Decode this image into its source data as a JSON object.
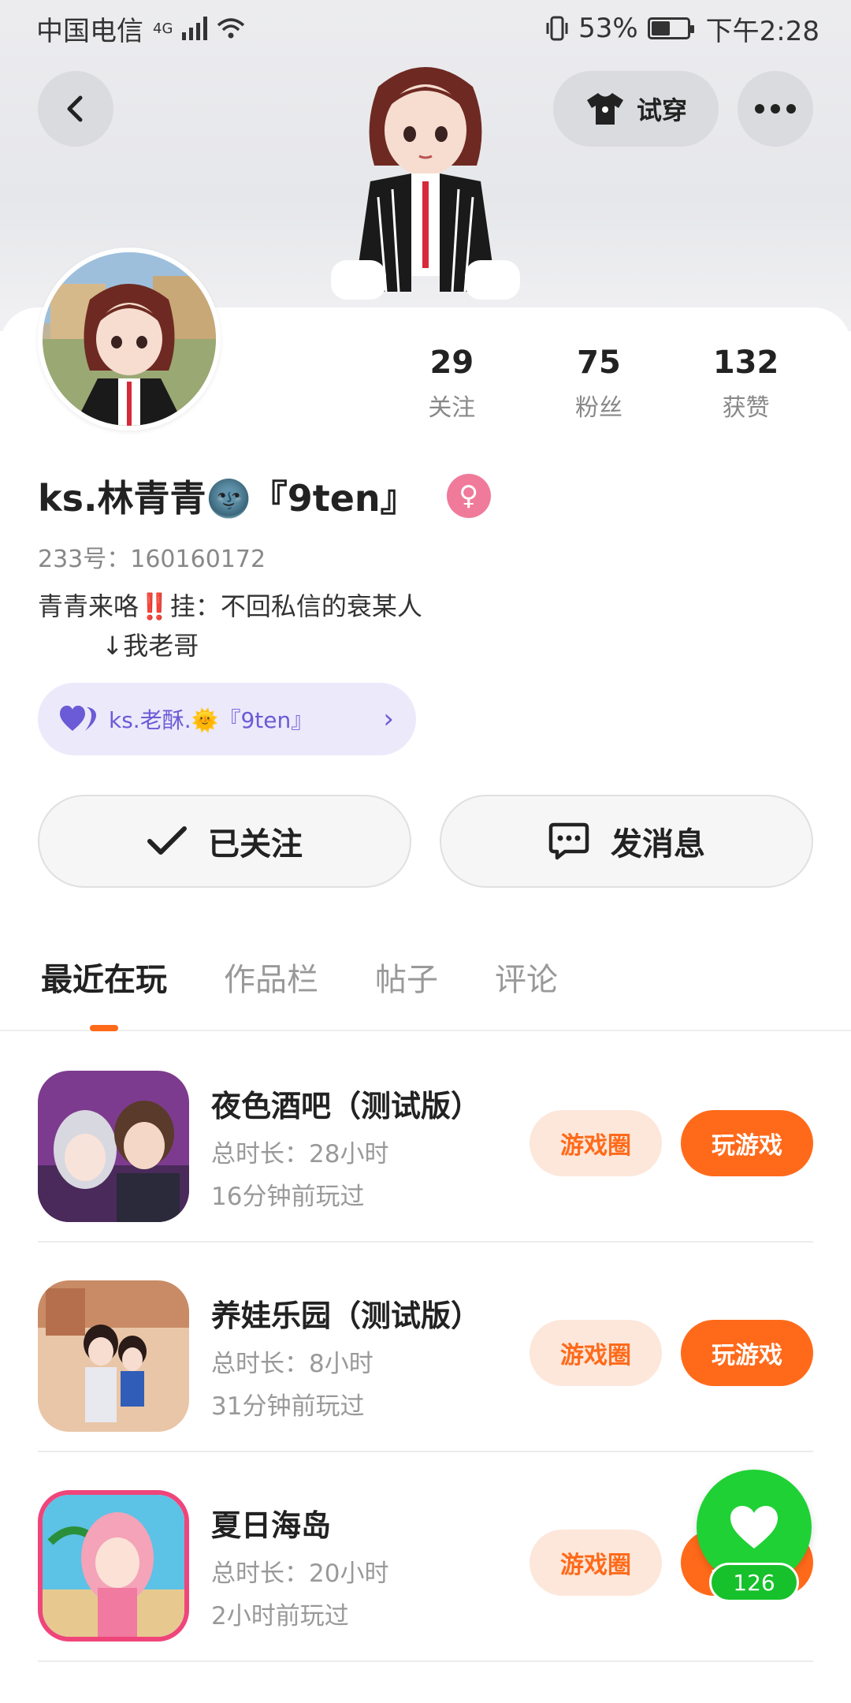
{
  "status_bar": {
    "carrier": "中国电信",
    "network": "4G",
    "battery": "53%",
    "battery_level": 0.53,
    "time": "下午2:28"
  },
  "top_bar": {
    "tryon_label": "试穿"
  },
  "profile": {
    "username": "ks.林青青🌚『9ten』",
    "gender_symbol": "♀",
    "uid": "233号：160160172",
    "bio": "青青来咯‼️挂：不回私信的衰某人\n        ↓我老哥",
    "relation_label": "ks.老酥.🌞『9ten』"
  },
  "stats": [
    {
      "value": "29",
      "label": "关注"
    },
    {
      "value": "75",
      "label": "粉丝"
    },
    {
      "value": "132",
      "label": "获赞"
    }
  ],
  "actions": {
    "follow_label": "已关注",
    "message_label": "发消息"
  },
  "tabs": [
    {
      "label": "最近在玩",
      "active": true
    },
    {
      "label": "作品栏",
      "active": false
    },
    {
      "label": "帖子",
      "active": false
    },
    {
      "label": "评论",
      "active": false
    }
  ],
  "games": [
    {
      "title": "夜色酒吧（测试版）",
      "total_time": "总时长：28小时",
      "last_played": "16分钟前玩过",
      "circle_label": "游戏圈",
      "play_label": "玩游戏"
    },
    {
      "title": "养娃乐园（测试版）",
      "total_time": "总时长：8小时",
      "last_played": "31分钟前玩过",
      "circle_label": "游戏圈",
      "play_label": "玩游戏"
    },
    {
      "title": "夏日海岛",
      "total_time": "总时长：20小时",
      "last_played": "2小时前玩过",
      "circle_label": "游戏圈",
      "play_label": "玩游戏"
    }
  ],
  "like_float": {
    "count": "126"
  },
  "colors": {
    "accent": "#ff6a1a",
    "accent_light": "#fde7da",
    "relation_bg": "#ece9fb",
    "relation_text": "#6b5bd6",
    "like_green": "#1fd135",
    "gender_pink": "#f07a9a"
  }
}
